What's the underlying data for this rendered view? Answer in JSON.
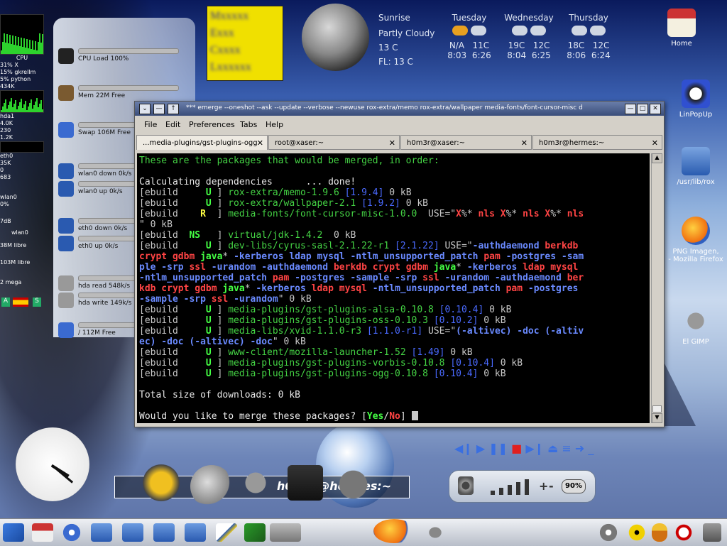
{
  "monitors": {
    "cpu_label": "CPU",
    "proc1": "31% X",
    "proc2": "15% gkrellm",
    "proc3": "5% python",
    "mem_top": "434K",
    "hda1": "hda1",
    "disk_read": "4.0K",
    "disk_230": "230",
    "disk_12k": "1.2K",
    "eth0": "eth0",
    "eth0_35k": "35K",
    "eth0_0": "0",
    "eth0_683": "683",
    "wlan0": "wlan0",
    "wlan0_pct": "0%",
    "wlan_7db": "7dB",
    "wlan0b": "wlan0",
    "free1": "38M libre",
    "free2": "103M libre",
    "mega": "2 mega",
    "kb_a": "A",
    "kb_s": "S"
  },
  "gauges": [
    {
      "text": "CPU Load 100%",
      "icon": "tux-icon"
    },
    {
      "text": "Mem 22M Free",
      "icon": "memory-icon"
    },
    {
      "text": "Swap 106M Free",
      "icon": "swap-icon"
    },
    {
      "text": "wlan0 down 0k/s",
      "icon": "network-icon"
    },
    {
      "text": "wlan0 up 0k/s",
      "icon": "network-icon"
    },
    {
      "text": "eth0 down 0k/s",
      "icon": "network-icon"
    },
    {
      "text": "eth0 up 0k/s",
      "icon": "network-icon"
    },
    {
      "text": "hda read 548k/s",
      "icon": "disk-icon"
    },
    {
      "text": "hda write 149k/s",
      "icon": "disk-icon"
    },
    {
      "text": "/ 112M Free",
      "icon": "drive-icon"
    }
  ],
  "weather": {
    "today": "Sunrise",
    "condition": "Partly Cloudy",
    "temp": "13 C",
    "feels": "FL: 13 C",
    "days": [
      {
        "name": "Tuesday",
        "hi1": "N/A",
        "hi2": "11C",
        "t1": "8:03",
        "t2": "6:26"
      },
      {
        "name": "Wednesday",
        "hi1": "19C",
        "hi2": "12C",
        "t1": "8:04",
        "t2": "6:25"
      },
      {
        "name": "Thursday",
        "hi1": "18C",
        "hi2": "12C",
        "t1": "8:06",
        "t2": "6:24"
      }
    ]
  },
  "desktop_icons": {
    "home": "Home",
    "linpopup": "LinPopUp",
    "usrlibrox": "/usr/lib/rox",
    "firefox1": "PNG Imagen,",
    "firefox2": "- Mozilla Firefox",
    "gimp": "El GIMP"
  },
  "terminal": {
    "title": "*** emerge --oneshot --ask --update --verbose --newuse rox-extra/memo rox-extra/wallpaper media-fonts/font-cursor-misc d",
    "menu": [
      "File",
      "Edit",
      "Preferences",
      "Tabs",
      "Help"
    ],
    "tabs": [
      "...media-plugins/gst-plugins-ogg",
      "root@xaser:~",
      "h0m3r@xaser:~",
      "h0m3r@hermes:~"
    ],
    "lines": {
      "l1": "These are the packages that would be merged, in order:",
      "l2": "Calculating dependencies      ... done!",
      "total": "Total size of downloads: 0 kB",
      "prompt_pre": "Would you like to merge these packages? [",
      "yes": "Yes",
      "slash": "/",
      "no": "No",
      "prompt_post": "] "
    }
  },
  "dock": {
    "caption": "h0m3r@hermes:~"
  },
  "volume": {
    "pct": "90%",
    "minus": "-",
    "plus": "+",
    "dash": "–"
  },
  "colors": {
    "accent": "#3a4d7a",
    "terminal_bg": "#000000",
    "green": "#44d244",
    "blue": "#4a6aff",
    "red": "#ff4444"
  }
}
